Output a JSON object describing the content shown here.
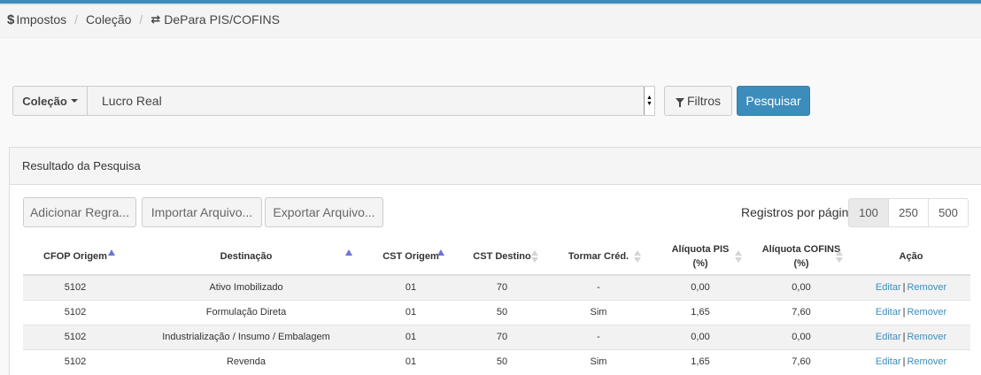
{
  "breadcrumb": {
    "items": [
      {
        "icon": "dollar-icon",
        "glyph": "$",
        "label": "Impostos"
      },
      {
        "label": "Coleção"
      },
      {
        "icon": "swap-icon",
        "glyph": "⇄",
        "label": "DePara PIS/COFINS"
      }
    ]
  },
  "search": {
    "dropdown_label": "Coleção",
    "selected_value": "Lucro Real",
    "filtros_label": "Filtros",
    "pesquisar_label": "Pesquisar"
  },
  "panel": {
    "title": "Resultado da Pesquisa",
    "add_label": "Adicionar Regra...",
    "import_label": "Importar Arquivo...",
    "export_label": "Exportar Arquivo...",
    "page_size_label": "Registros por página",
    "page_sizes": [
      "100",
      "250",
      "500"
    ],
    "active_page_size": "100"
  },
  "table": {
    "headers": [
      "CFOP Origem",
      "Destinação",
      "CST Origem",
      "CST Destino",
      "Tormar Créd.",
      "Alíquota PIS",
      "(%)",
      "Alíquota COFINS",
      "(%)",
      "Ação"
    ],
    "rows": [
      {
        "cfop": "5102",
        "destinacao": "Ativo Imobilizado",
        "cst_origem": "01",
        "cst_destino": "70",
        "credito": "-",
        "pis": "0,00",
        "cofins": "0,00"
      },
      {
        "cfop": "5102",
        "destinacao": "Formulação Direta",
        "cst_origem": "01",
        "cst_destino": "50",
        "credito": "Sim",
        "pis": "1,65",
        "cofins": "7,60"
      },
      {
        "cfop": "5102",
        "destinacao": "Industrialização / Insumo / Embalagem",
        "cst_origem": "01",
        "cst_destino": "70",
        "credito": "-",
        "pis": "0,00",
        "cofins": "0,00"
      },
      {
        "cfop": "5102",
        "destinacao": "Revenda",
        "cst_origem": "01",
        "cst_destino": "50",
        "credito": "Sim",
        "pis": "1,65",
        "cofins": "7,60"
      }
    ],
    "action_edit": "Editar",
    "action_sep": "|",
    "action_remove": "Remover"
  },
  "colors": {
    "accent": "#3c8dbc",
    "sort_active": "#6f72d6"
  }
}
